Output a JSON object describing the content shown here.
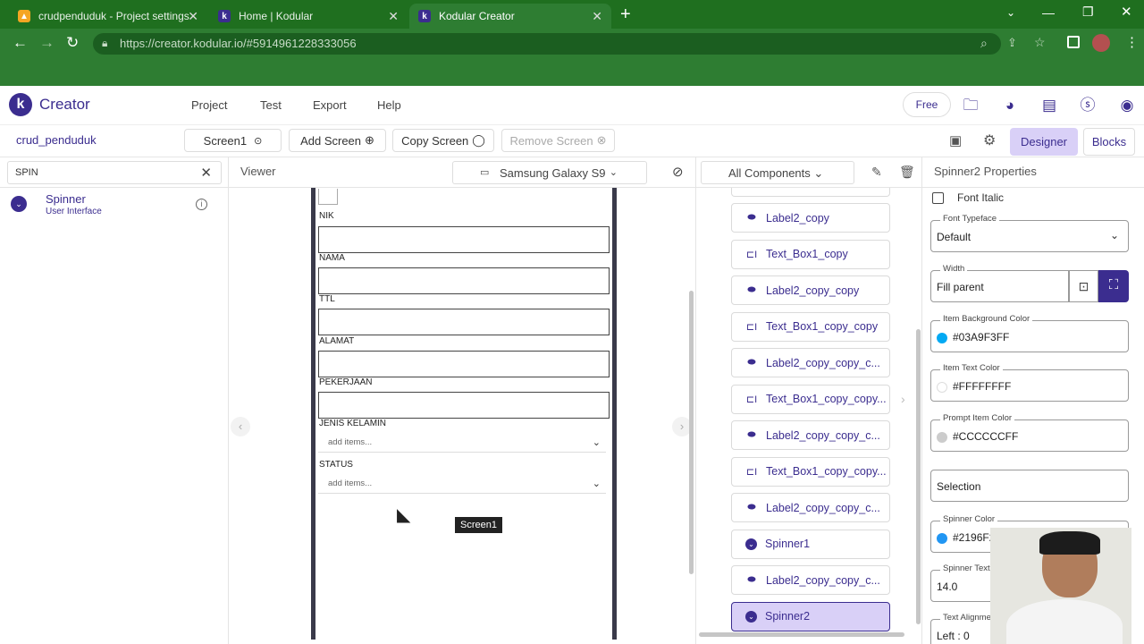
{
  "browser": {
    "tabs": [
      {
        "title": "crudpenduduk - Project settings",
        "active": false
      },
      {
        "title": "Home | Kodular",
        "active": false
      },
      {
        "title": "Kodular Creator",
        "active": true
      }
    ],
    "url": "https://creator.kodular.io/#5914961228333056"
  },
  "header": {
    "logo_letter": "k",
    "brand": "Creator",
    "menu": [
      "Project",
      "Test",
      "Export",
      "Help"
    ],
    "plan_button": "Free"
  },
  "toolbar": {
    "project_name": "crud_penduduk",
    "screen_select": "Screen1",
    "add_screen": "Add Screen",
    "copy_screen": "Copy Screen",
    "remove_screen": "Remove Screen",
    "designer": "Designer",
    "blocks": "Blocks"
  },
  "palette": {
    "search_value": "SPIN",
    "items": [
      {
        "name": "Spinner",
        "category": "User Interface"
      }
    ]
  },
  "viewer": {
    "title": "Viewer",
    "device": "Samsung Galaxy S9",
    "fields": [
      "NIK",
      "NAMA",
      "TTL",
      "ALAMAT",
      "PEKERJAAN"
    ],
    "spinners": [
      {
        "label": "JENIS KELAMIN",
        "placeholder": "add items..."
      },
      {
        "label": "STATUS",
        "placeholder": "add items..."
      }
    ],
    "tooltip": "Screen1"
  },
  "components": {
    "filter": "All Components",
    "items": [
      {
        "name": "Label2_copy",
        "type": "label"
      },
      {
        "name": "Text_Box1_copy",
        "type": "textbox"
      },
      {
        "name": "Label2_copy_copy",
        "type": "label"
      },
      {
        "name": "Text_Box1_copy_copy",
        "type": "textbox"
      },
      {
        "name": "Label2_copy_copy_c...",
        "type": "label"
      },
      {
        "name": "Text_Box1_copy_copy...",
        "type": "textbox"
      },
      {
        "name": "Label2_copy_copy_c...",
        "type": "label"
      },
      {
        "name": "Text_Box1_copy_copy...",
        "type": "textbox"
      },
      {
        "name": "Label2_copy_copy_c...",
        "type": "label"
      },
      {
        "name": "Spinner1",
        "type": "spinner"
      },
      {
        "name": "Label2_copy_copy_c...",
        "type": "label"
      },
      {
        "name": "Spinner2",
        "type": "spinner",
        "selected": true
      }
    ]
  },
  "properties": {
    "title": "Spinner2 Properties",
    "font_italic_label": "Font Italic",
    "font_typeface": {
      "label": "Font Typeface",
      "value": "Default"
    },
    "width": {
      "label": "Width",
      "value": "Fill parent"
    },
    "item_bg_color": {
      "label": "Item Background Color",
      "value": "#03A9F3FF",
      "swatch": "#03A9F3"
    },
    "item_text_color": {
      "label": "Item Text Color",
      "value": "#FFFFFFFF",
      "swatch": "#FFFFFF"
    },
    "prompt_item_color": {
      "label": "Prompt Item Color",
      "value": "#CCCCCCFF",
      "swatch": "#CCCCCC"
    },
    "selection": {
      "label": "",
      "value": "Selection"
    },
    "spinner_color": {
      "label": "Spinner Color",
      "value": "#2196F2",
      "swatch": "#2196F3"
    },
    "spinner_text": {
      "label": "Spinner Text",
      "value": "14.0"
    },
    "text_alignment": {
      "label": "Text Alignme",
      "value": "Left : 0"
    }
  },
  "colors": {
    "accent": "#3b2d8f",
    "selected_bg": "#d9d0f7",
    "browser_green": "#2e7d32"
  }
}
